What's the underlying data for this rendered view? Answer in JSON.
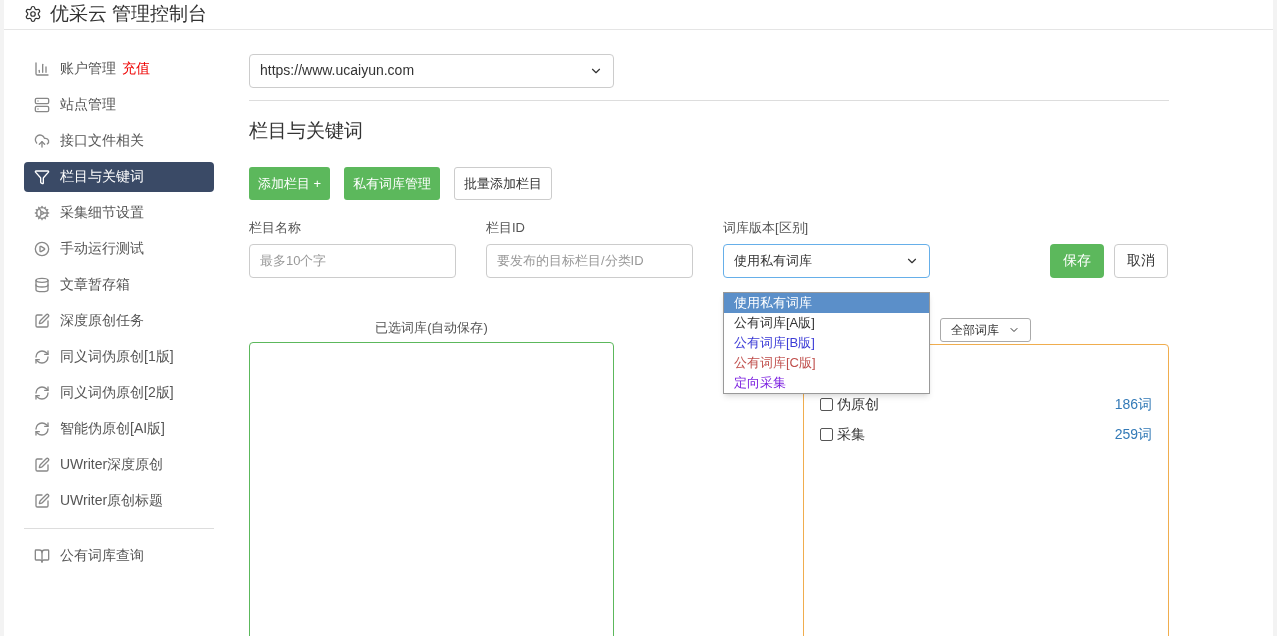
{
  "header": {
    "title": "优采云 管理控制台"
  },
  "sidebar": {
    "groups": [
      [
        {
          "label": "账户管理",
          "badge": "充值",
          "selected": false
        },
        {
          "label": "站点管理",
          "selected": false
        },
        {
          "label": "接口文件相关",
          "selected": false
        },
        {
          "label": "栏目与关键词",
          "selected": true
        },
        {
          "label": "采集细节设置",
          "selected": false
        },
        {
          "label": "手动运行测试",
          "selected": false
        },
        {
          "label": "文章暂存箱",
          "selected": false
        },
        {
          "label": "深度原创任务",
          "selected": false
        },
        {
          "label": "同义词伪原创[1版]",
          "selected": false
        },
        {
          "label": "同义词伪原创[2版]",
          "selected": false
        },
        {
          "label": "智能伪原创[AI版]",
          "selected": false
        },
        {
          "label": "UWriter深度原创",
          "selected": false
        },
        {
          "label": "UWriter原创标题",
          "selected": false
        }
      ],
      [
        {
          "label": "公有词库查询",
          "selected": false
        }
      ]
    ]
  },
  "site_select": {
    "value": "https://www.ucaiyun.com"
  },
  "section_title": "栏目与关键词",
  "toolbar": [
    {
      "label": "添加栏目 +",
      "kind": "primary"
    },
    {
      "label": "私有词库管理",
      "kind": "primary"
    },
    {
      "label": "批量添加栏目",
      "kind": "default"
    }
  ],
  "form": {
    "name": {
      "label": "栏目名称",
      "placeholder": "最多10个字"
    },
    "id": {
      "label": "栏目ID",
      "placeholder": "要发布的目标栏目/分类ID"
    },
    "library": {
      "label": "词库版本[区别]",
      "value": "使用私有词库",
      "options": [
        {
          "label": "使用私有词库",
          "selected": true
        },
        {
          "label": "公有词库[A版]",
          "selected": false,
          "color": "#333333"
        },
        {
          "label": "公有词库[B版]",
          "selected": false,
          "color": "#3b3bd6"
        },
        {
          "label": "公有词库[C版]",
          "selected": false,
          "color": "#c0504d"
        },
        {
          "label": "定向采集",
          "selected": false,
          "color": "#7b1fe0"
        }
      ]
    },
    "save": "保存",
    "cancel": "取消"
  },
  "selected_label": "已选词库(自动保存)",
  "filter_select": {
    "value": "全部词库"
  },
  "library_list": [
    {
      "label": "伪原创",
      "count": "186词",
      "checked": false
    },
    {
      "label": "采集",
      "count": "259词",
      "checked": false
    }
  ]
}
